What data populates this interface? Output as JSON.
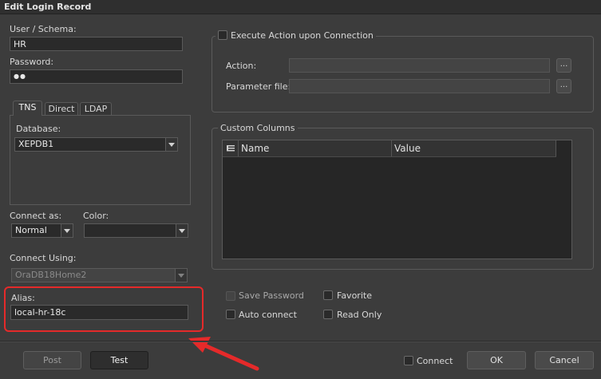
{
  "window": {
    "title": "Edit Login Record"
  },
  "login": {
    "user_label": "User / Schema:",
    "user_value": "HR",
    "password_label": "Password:",
    "password_value": "●●"
  },
  "tabs": [
    {
      "label": "TNS",
      "active": true
    },
    {
      "label": "Direct",
      "active": false
    },
    {
      "label": "LDAP",
      "active": false
    }
  ],
  "tns": {
    "database_label": "Database:",
    "database_value": "XEPDB1"
  },
  "connect_as": {
    "label": "Connect as:",
    "value": "Normal"
  },
  "color": {
    "label": "Color:",
    "value": ""
  },
  "connect_using": {
    "label": "Connect Using:",
    "value": "OraDB18Home2"
  },
  "alias": {
    "label": "Alias:",
    "value": "local-hr-18c"
  },
  "execute_action": {
    "checkbox_label": "Execute Action upon Connection",
    "action_label": "Action:",
    "action_value": "",
    "param_label": "Parameter file:",
    "param_value": "",
    "ellipsis": "..."
  },
  "custom_columns": {
    "title": "Custom Columns",
    "columns": [
      "Name",
      "Value"
    ],
    "header_icon": "grid-menu-icon"
  },
  "options": {
    "save_password": "Save Password",
    "favorite": "Favorite",
    "auto_connect": "Auto connect",
    "read_only": "Read Only"
  },
  "buttons": {
    "post": "Post",
    "test": "Test",
    "connect": "Connect",
    "ok": "OK",
    "cancel": "Cancel"
  },
  "colors": {
    "highlight": "#e52a2a",
    "background": "#3c3c3c"
  }
}
